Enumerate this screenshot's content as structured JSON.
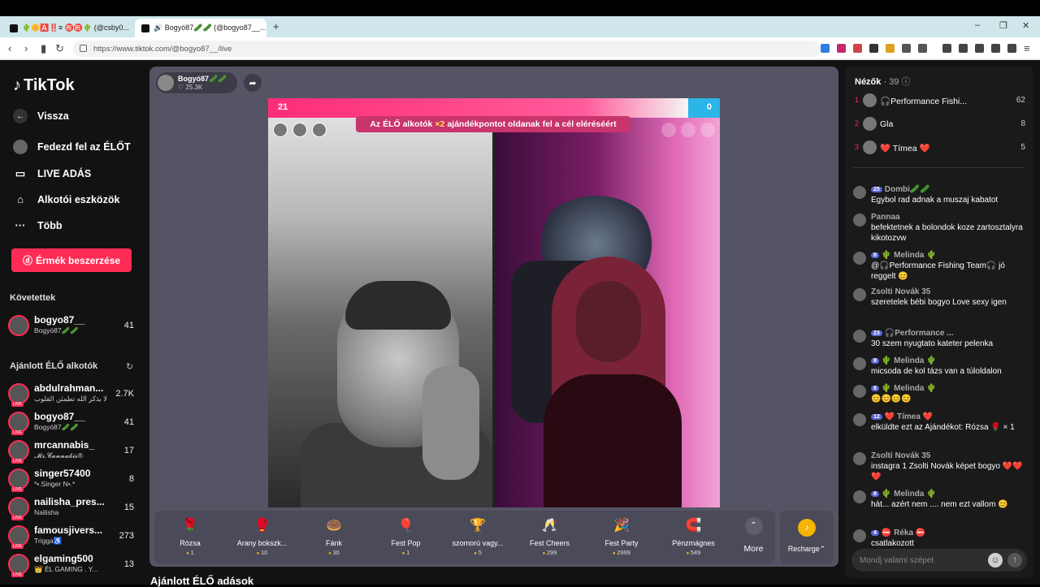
{
  "browser": {
    "tabs": [
      {
        "label": "🌵🌼🅰️‼️≡ ㊗️㊗️🌵 (@csby0..."
      },
      {
        "label": "🔊 Bogyó87🥒🥒 (@bogyo87__..."
      }
    ],
    "url": "https://www.tiktok.com/@bogyo87__/live",
    "new_tab": "+",
    "close": "✕"
  },
  "sidebar": {
    "logo": "TikTok",
    "nav": [
      {
        "label": "Vissza",
        "icon": "back-icon"
      },
      {
        "label": "Fedezd fel az ÉLŐT",
        "icon": "avatar-icon"
      },
      {
        "label": "LIVE ADÁS",
        "icon": "camera-icon"
      },
      {
        "label": "Alkotói eszközök",
        "icon": "lightbulb-icon"
      },
      {
        "label": "Több",
        "icon": "more-icon"
      }
    ],
    "coins_button": "Érmék beszerzése",
    "following_title": "Követettek",
    "following": [
      {
        "name": "bogyo87__",
        "sub": "Bogyó87🥒🥒",
        "count": "41"
      }
    ],
    "suggested_title": "Ajánlott ÉLŐ alkotók",
    "suggested": [
      {
        "name": "abdulrahman...",
        "sub": "ألا بذكر الله تطمئن القلوب ...",
        "count": "2.7K"
      },
      {
        "name": "bogyo87__",
        "sub": "Bogyó87🥒🥒",
        "count": "41"
      },
      {
        "name": "mrcannabis_",
        "sub": "𝓜𝓻.𝓒𝓪𝓷𝓷𝓪𝓫𝓲𝓼®",
        "count": "17"
      },
      {
        "name": "singer57400",
        "sub": "*•.Singer N•.*",
        "count": "8"
      },
      {
        "name": "nailisha_pres...",
        "sub": "Nailisha",
        "count": "15"
      },
      {
        "name": "famousjivers...",
        "sub": "Trigga♿",
        "count": "273"
      },
      {
        "name": "elgaming500",
        "sub": "👑 ÉL GAMING . Y...",
        "count": "13"
      }
    ]
  },
  "stream": {
    "host_name": "Bogyó87🥒🥒",
    "likes": "♡ 25.3K",
    "score_left": "21",
    "score_right": "0",
    "banner_pre": "Az ÉLŐ alkotók",
    "banner_mult": "×2",
    "banner_post": "ajándékpontot oldanak fel a cél eléréséért",
    "rank_badges": [
      "3",
      "2",
      "1"
    ]
  },
  "gifts": [
    {
      "name": "Rózsa",
      "cost": "1",
      "icon": "🌹",
      "color": "#e8344e"
    },
    {
      "name": "Arany bokszk...",
      "cost": "10",
      "icon": "🥊",
      "color": "#f3d37a"
    },
    {
      "name": "Fánk",
      "cost": "30",
      "icon": "🍩",
      "color": "#f6a6c5"
    },
    {
      "name": "Fest Pop",
      "cost": "1",
      "icon": "🎈",
      "color": "#4ad0f0"
    },
    {
      "name": "szomorú vagy...",
      "cost": "5",
      "icon": "🏆",
      "color": "#5a70e8"
    },
    {
      "name": "Fest Cheers",
      "cost": "299",
      "icon": "🥂",
      "color": "#c47bf0"
    },
    {
      "name": "Fest Party",
      "cost": "2999",
      "icon": "🎉",
      "color": "#e05bd8"
    },
    {
      "name": "Pénzmágnes",
      "cost": "549",
      "icon": "🧲",
      "color": "#9fc2f0"
    }
  ],
  "more_label": "More",
  "recharge_label": "Recharge⌃",
  "below_title": "Ajánlott ÉLŐ adások",
  "chat": {
    "viewers_title": "Nézők",
    "viewers_count": "· 39",
    "viewers": [
      {
        "rank": "1",
        "name": "🎧Performance Fishi...",
        "score": "62"
      },
      {
        "rank": "2",
        "name": "Gla",
        "score": "8"
      },
      {
        "rank": "3",
        "name": "❤️ Tímea ❤️",
        "score": "5"
      }
    ],
    "messages": [
      {
        "user": "Dombi🥒🥒",
        "badge": "25",
        "text": "Egybol rad adnak a muszaj kabatot"
      },
      {
        "user": "Pannaa",
        "badge": "",
        "text": "befektetnek a bolondok koze zartosztalyra kikotozvw"
      },
      {
        "user": "🌵 Melinda 🌵",
        "badge": "8",
        "text": "@🎧Performance Fishing Team🎧 jó reggelt 😊"
      },
      {
        "user": "Zsolti Novák 35",
        "badge": "",
        "text": "szeretelek bébi bogyo Love sexy igen"
      },
      {
        "user": "🎧Performance ...",
        "badge": "23",
        "text": "30 szem nyugtato kateter pelenka"
      },
      {
        "user": "🌵 Melinda 🌵",
        "badge": "8",
        "text": "micsoda de kol tázs van a túloldalon"
      },
      {
        "user": "🌵 Melinda 🌵",
        "badge": "8",
        "text": "😊😊😊😊"
      },
      {
        "user": "❤️ Tímea ❤️",
        "badge": "12",
        "text": "elküldte ezt az Ajándékot: Rózsa 🌹 × 1"
      },
      {
        "user": "Zsolti Novák 35",
        "badge": "",
        "text": "instagra 1 Zsolti Novák képet bogyo ❤️❤️❤️"
      },
      {
        "user": "🌵 Melinda 🌵",
        "badge": "8",
        "text": "hát... azért nem .... nem ezt vallom 😊"
      },
      {
        "user": "⛔ Réka ⛔",
        "badge": "4",
        "text": "csatlakozott"
      }
    ],
    "input_placeholder": "Mondj valami szépet"
  }
}
